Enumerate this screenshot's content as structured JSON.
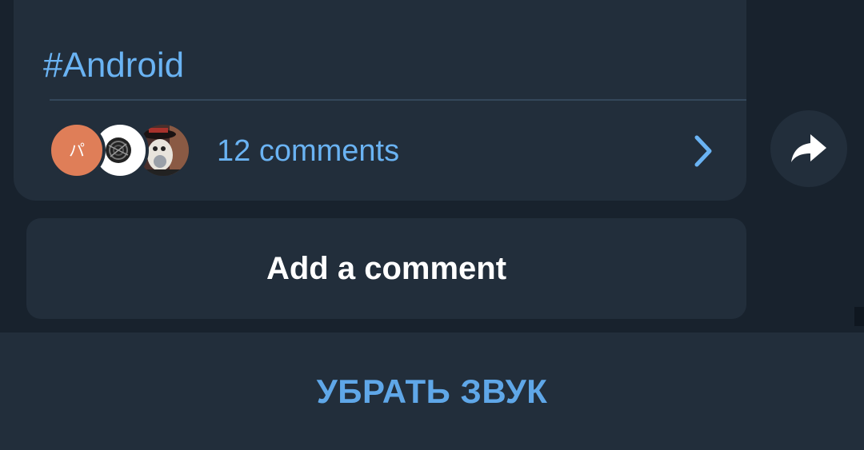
{
  "message": {
    "hashtag": "#Android",
    "comments": {
      "count_label": "12 comments",
      "avatars": [
        {
          "initial": "パ",
          "color": "#df7e58"
        },
        {
          "color": "#ffffff"
        },
        {
          "color": "#3a3330"
        }
      ]
    }
  },
  "share": {
    "icon": "share-arrow-icon"
  },
  "add_comment": {
    "label": "Add a comment"
  },
  "bottom_bar": {
    "label": "УБРАТЬ ЗВУК"
  },
  "colors": {
    "background": "#18222d",
    "surface": "#222e3b",
    "accent": "#6ab3f3",
    "text": "#ffffff"
  }
}
